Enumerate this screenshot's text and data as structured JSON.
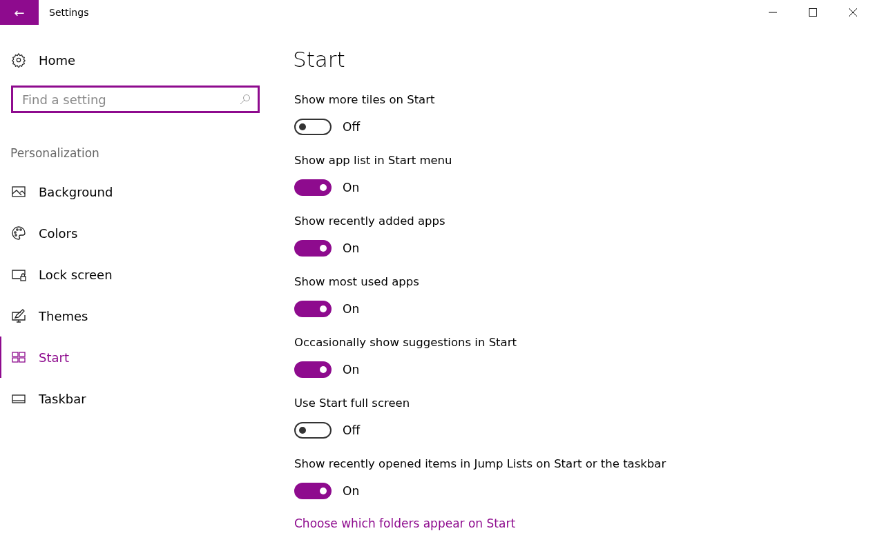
{
  "window": {
    "title": "Settings",
    "back_button": "←"
  },
  "sidebar": {
    "home": "Home",
    "search": {
      "placeholder": "Find a setting"
    },
    "section": "Personalization",
    "items": [
      {
        "label": "Background",
        "selected": false
      },
      {
        "label": "Colors",
        "selected": false
      },
      {
        "label": "Lock screen",
        "selected": false
      },
      {
        "label": "Themes",
        "selected": false
      },
      {
        "label": "Start",
        "selected": true
      },
      {
        "label": "Taskbar",
        "selected": false
      }
    ]
  },
  "page": {
    "title": "Start",
    "settings": [
      {
        "label": "Show more tiles on Start",
        "on": false,
        "state": "Off"
      },
      {
        "label": "Show app list in Start menu",
        "on": true,
        "state": "On"
      },
      {
        "label": "Show recently added apps",
        "on": true,
        "state": "On"
      },
      {
        "label": "Show most used apps",
        "on": true,
        "state": "On"
      },
      {
        "label": "Occasionally show suggestions in Start",
        "on": true,
        "state": "On"
      },
      {
        "label": "Use Start full screen",
        "on": false,
        "state": "Off"
      },
      {
        "label": "Show recently opened items in Jump Lists on Start or the taskbar",
        "on": true,
        "state": "On"
      }
    ],
    "link": "Choose which folders appear on Start"
  }
}
